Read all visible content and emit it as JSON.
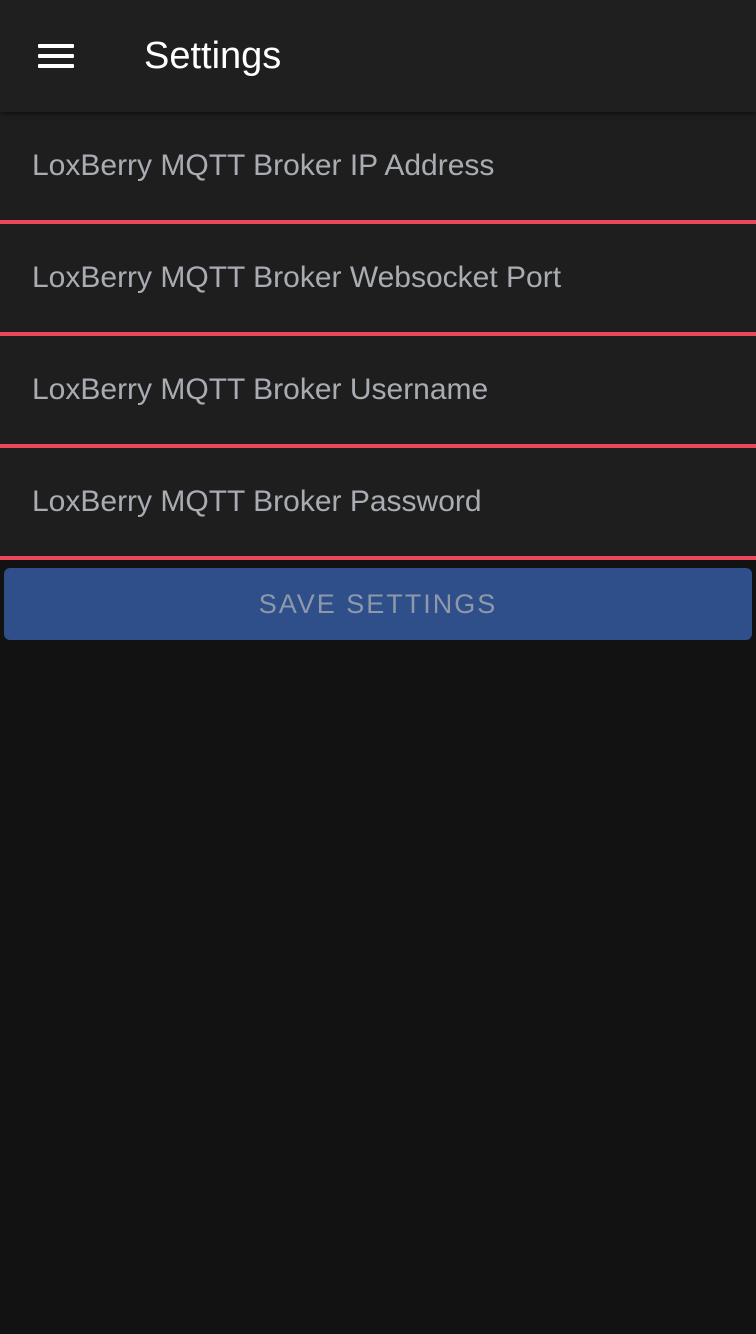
{
  "header": {
    "title": "Settings",
    "menu_icon": "hamburger-menu-icon"
  },
  "form": {
    "fields": [
      {
        "placeholder": "LoxBerry MQTT Broker IP Address",
        "value": ""
      },
      {
        "placeholder": "LoxBerry MQTT Broker Websocket Port",
        "value": ""
      },
      {
        "placeholder": "LoxBerry MQTT Broker Username",
        "value": ""
      },
      {
        "placeholder": "LoxBerry MQTT Broker Password",
        "value": ""
      }
    ],
    "save_label": "SAVE SETTINGS"
  },
  "colors": {
    "background": "#121212",
    "header_bg": "#1f1f1f",
    "field_bg": "#1e1e1e",
    "field_underline": "#e8485a",
    "button_bg": "#2f4f8b",
    "button_text": "#8f98a8",
    "placeholder_text": "#a9acb3"
  }
}
